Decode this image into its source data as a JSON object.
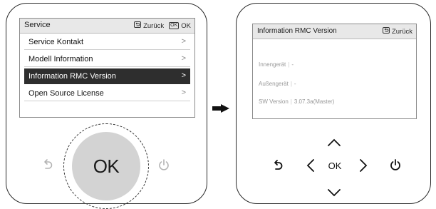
{
  "left_panel": {
    "header": {
      "title": "Service",
      "back_label": "Zurück",
      "ok_icon_text": "OK",
      "ok_label": "OK"
    },
    "menu_items": [
      {
        "label": "Service Kontakt",
        "chevron": ">"
      },
      {
        "label": "Modell Information",
        "chevron": ">"
      },
      {
        "label": "Information RMC Version",
        "chevron": ">",
        "selected": true
      },
      {
        "label": "Open Source License",
        "chevron": ">"
      }
    ],
    "controls": {
      "ok_button": "OK",
      "back_icon": "back-icon",
      "power_icon": "power-icon"
    }
  },
  "right_panel": {
    "header": {
      "title": "Information RMC Version",
      "back_label": "Zurück"
    },
    "info": [
      {
        "label": "Innengerät",
        "value": "-"
      },
      {
        "label": "Außengerät",
        "value": "-"
      },
      {
        "label": "SW Version",
        "value": "3.07.3a(Master)"
      }
    ],
    "controls": {
      "ok_label": "OK",
      "up_icon": "chevron-up-icon",
      "down_icon": "chevron-down-icon",
      "left_icon": "chevron-left-icon",
      "right_icon": "chevron-right-icon",
      "back_icon": "back-icon",
      "power_icon": "power-icon"
    }
  },
  "colors": {
    "selected_row": "#2e2e2e",
    "header_bar": "#e8e8e8",
    "ok_button_fill": "#d3d3d3",
    "outline": "#2a2a2a"
  }
}
